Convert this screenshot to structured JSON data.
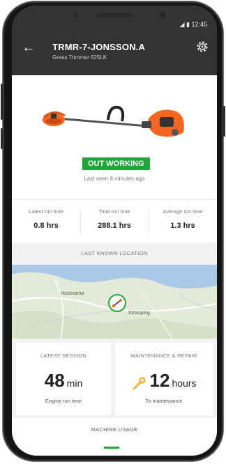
{
  "status_bar": {
    "time": "12:45"
  },
  "app_bar": {
    "title": "TRMR-7-JONSSON.A",
    "subtitle": "Grass Trimmer 525LK"
  },
  "device": {
    "status_badge": "OUT WORKING",
    "last_seen": "Last seen 8 minutes ago"
  },
  "stats": [
    {
      "label": "Latest run time",
      "value": "0.8 hrs"
    },
    {
      "label": "Total run time",
      "value": "288.1 hrs"
    },
    {
      "label": "Average run time",
      "value": "1.3 hrs"
    }
  ],
  "location": {
    "header": "LAST KNOWN LOCATION",
    "map_labels": [
      "Huskvarna",
      "Jönköping"
    ]
  },
  "latest_session": {
    "title": "LATEST SESSION",
    "value": "48",
    "unit": "min",
    "caption": "Engine run time"
  },
  "maintenance": {
    "title": "MAINTENANCE & REPAIR",
    "value": "12",
    "unit": "hours",
    "caption": "To maintenance"
  },
  "usage": {
    "title": "MACHINE USAGE"
  },
  "colors": {
    "status_green": "#1fa53a",
    "appbar_dark": "#333333",
    "product_orange": "#f26522",
    "wrench_yellow": "#f2b134"
  }
}
